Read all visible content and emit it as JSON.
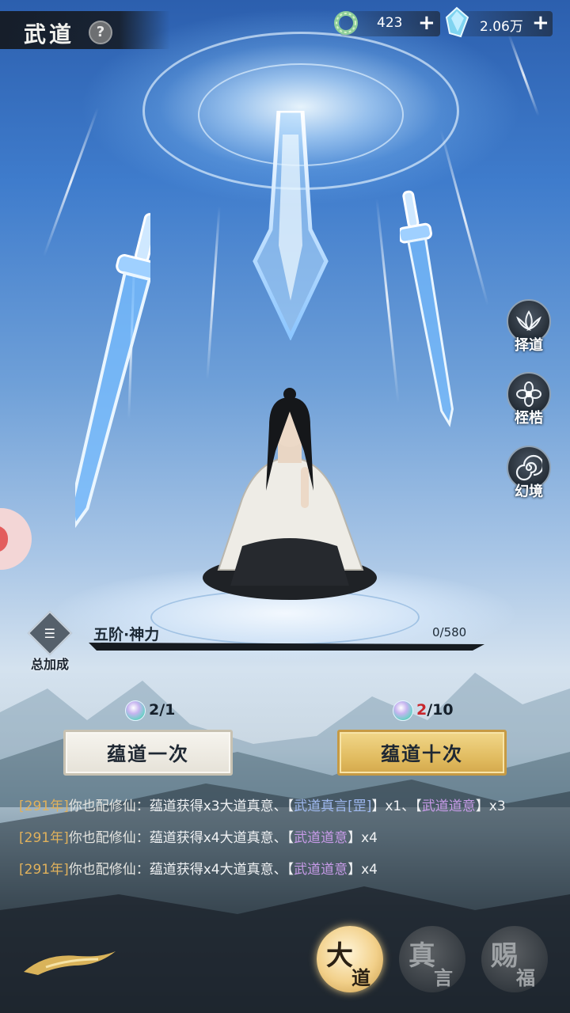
{
  "header": {
    "title": "武道",
    "help_icon": "?"
  },
  "resources": [
    {
      "icon": "jade-ring-icon",
      "value": "423",
      "add": "+"
    },
    {
      "icon": "spirit-crystal-icon",
      "value": "2.06万",
      "add": "+"
    }
  ],
  "side_menu": [
    {
      "icon": "lotus-icon",
      "label": "择道"
    },
    {
      "icon": "flower-icon",
      "label": "桎梏"
    },
    {
      "icon": "spiral-icon",
      "label": "幻境"
    }
  ],
  "stage": {
    "name": "五阶·神力",
    "progress_text": "0/580",
    "progress_fraction": 0.0
  },
  "bonus": {
    "icon": "list-icon",
    "label": "总加成"
  },
  "draw_once": {
    "cost_have": "2",
    "cost_need": "/1",
    "label": "蕴道一次"
  },
  "draw_ten": {
    "cost_have": "2",
    "cost_need": "/10",
    "label": "蕴道十次"
  },
  "log": [
    {
      "year": "[291年]",
      "who": "你也配修仙：",
      "text": "蕴道获得x3大道真意、【",
      "item1": "武道真言[罡]",
      "mid": "】x1、【",
      "item2": "武道道意",
      "tail": "】x3"
    },
    {
      "year": "[291年]",
      "who": "你也配修仙：",
      "text": "蕴道获得x4大道真意、【",
      "item2": "武道道意",
      "tail": "】x4"
    },
    {
      "year": "[291年]",
      "who": "你也配修仙：",
      "text": "蕴道获得x4大道真意、【",
      "item2": "武道道意",
      "tail": "】x4"
    }
  ],
  "bottom_nav": [
    {
      "big": "大",
      "small": "道",
      "active": true
    },
    {
      "big": "真",
      "small": "言",
      "active": false
    },
    {
      "big": "赐",
      "small": "福",
      "active": false
    }
  ],
  "colors": {
    "accent_gold": "#e2bd62",
    "log_year": "#e0b15c",
    "rare_blue": "#9fb9f0",
    "rare_purple": "#c79be8",
    "cost_shortfall": "#c8262c"
  }
}
